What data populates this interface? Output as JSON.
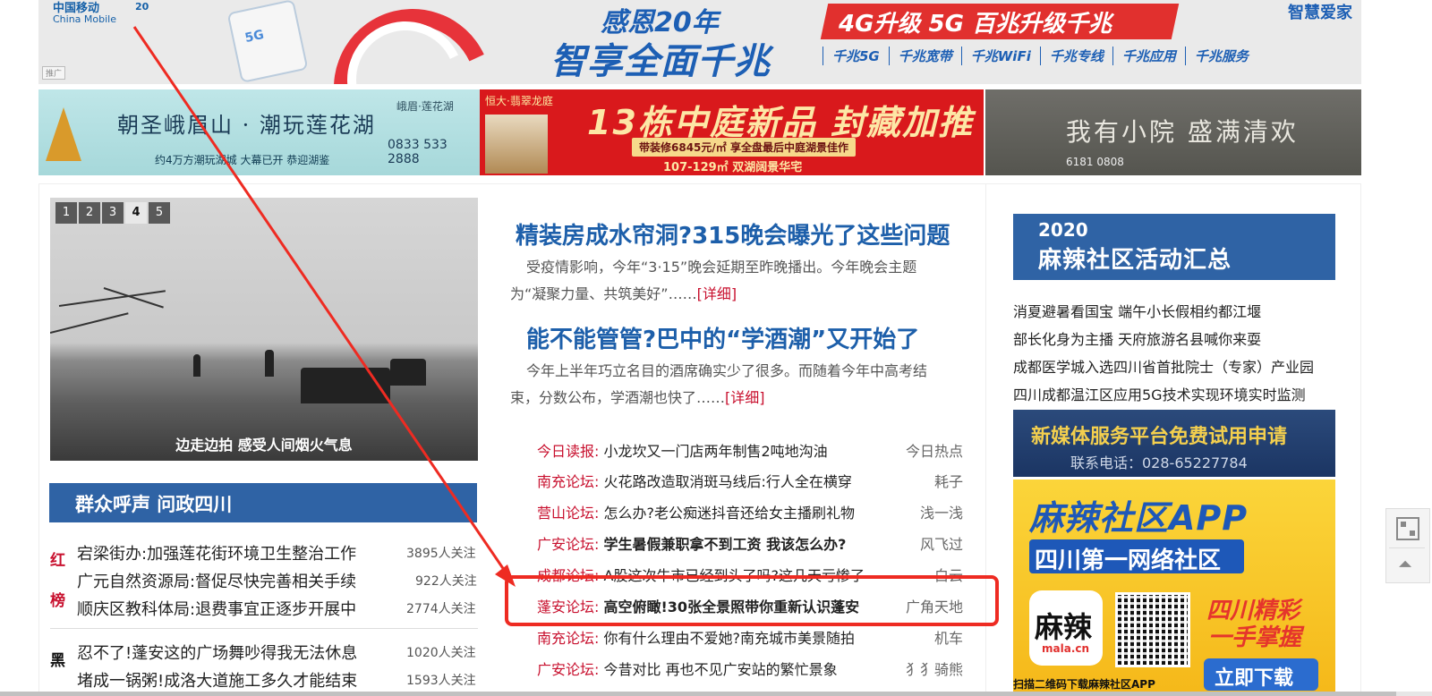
{
  "top_banner": {
    "cm_name": "中国移动",
    "cm_en": "China Mobile",
    "anniv": "20",
    "ad_tag": "推广",
    "phone_5g": "5G",
    "title_line1": "感恩20年",
    "title_line2": "智享全面千兆",
    "upgrade": "4G升级 5G   百兆升级千兆",
    "services": [
      "千兆5G",
      "千兆宽带",
      "千兆WiFi",
      "千兆专线",
      "千兆应用",
      "千兆服务"
    ],
    "smart_home": "智慧爱家"
  },
  "ads_row": {
    "a": {
      "title": "朝圣峨眉山 · 潮玩莲花湖",
      "brand": "峨眉·莲花湖",
      "phone": "0833 533 2888",
      "bottom": "约4万方潮玩湖城 大幕已开 恭迎湖鉴"
    },
    "b": {
      "brand": "恒大·翡翠龙庭",
      "title": "13栋中庭新品 封藏加推",
      "price": "带装修6845元/㎡ 享全盘最后中庭湖景佳作",
      "area": "107-129㎡ 双湖阔景华宅"
    },
    "c": {
      "title": "我有小院  盛满清欢",
      "phone": "6181 0808"
    }
  },
  "slideshow": {
    "pages": [
      "1",
      "2",
      "3",
      "4",
      "5"
    ],
    "active": "4",
    "caption": "边走边拍 感受人间烟火气息"
  },
  "voice": {
    "title": "群众呼声 问政四川",
    "red_label": [
      "红",
      "榜"
    ],
    "black_label": [
      "黑"
    ],
    "red_items": [
      {
        "title": "宕梁街办:加强莲花街环境卫生整治工作",
        "count": "3895人关注"
      },
      {
        "title": "广元自然资源局:督促尽快完善相关手续",
        "count": "922人关注"
      },
      {
        "title": "顺庆区教科体局:退费事宜正逐步开展中",
        "count": "2774人关注"
      }
    ],
    "black_items": [
      {
        "title": "忍不了!蓬安这的广场舞吵得我无法休息",
        "count": "1020人关注"
      },
      {
        "title": "堵成一锅粥!成洛大道施工多久才能结束",
        "count": "1593人关注"
      }
    ]
  },
  "headlines": [
    {
      "title": "精装房成水帘洞?315晚会曝光了这些问题",
      "line1": "受疫情影响，今年“3·15”晚会延期至昨晚播出。今年晚会主题",
      "line2": "为“凝聚力量、共筑美好”……",
      "more": "[详细]"
    },
    {
      "title": "能不能管管?巴中的“学酒潮”又开始了",
      "line1": "今年上半年巧立名目的酒席确实少了很多。而随着今年中高考结",
      "line2": "束，分数公布，学酒潮也快了……",
      "more": "[详细]"
    }
  ],
  "news": [
    {
      "src": "今日读报:",
      "title": "小龙坎又一门店两年制售2吨地沟油",
      "author": "今日热点",
      "bold": false
    },
    {
      "src": "南充论坛:",
      "title": "火花路改造取消斑马线后:行人全在横穿",
      "author": "耗子",
      "bold": false
    },
    {
      "src": "营山论坛:",
      "title": "怎么办?老公痴迷抖音还给女主播刷礼物",
      "author": "浅一浅",
      "bold": false
    },
    {
      "src": "广安论坛:",
      "title": "学生暑假兼职拿不到工资 我该怎么办?",
      "author": "风飞过",
      "bold": true
    },
    {
      "src": "成都论坛:",
      "title": "A股这次牛市已经到头了吗?这几天亏惨了",
      "author": "白云",
      "bold": false
    },
    {
      "src": "蓬安论坛:",
      "title": "高空俯瞰!30张全景照带你重新认识蓬安",
      "author": "广角天地",
      "bold": true
    },
    {
      "src": "南充论坛:",
      "title": "你有什么理由不爱她?南充城市美景随拍",
      "author": "机车",
      "bold": false
    },
    {
      "src": "广安论坛:",
      "title": "今昔对比 再也不见广安站的繁忙景象",
      "author": "犭犭骑熊",
      "bold": false
    }
  ],
  "right": {
    "summary_year": "2020",
    "summary_title": "麻辣社区活动汇总",
    "links": [
      "消夏避暑看国宝 端午小长假相约都江堰",
      "部长化身为主播 天府旅游名县喊你来耍",
      "成都医学城入选四川省首批院士（专家）产业园",
      "四川成都温江区应用5G技术实现环境实时监测"
    ],
    "media_title": "新媒体服务平台免费试用申请",
    "media_phone": "联系电话：028-65227784",
    "app_title": "麻辣社区APP",
    "app_sub": "四川第一网络社区",
    "app_icon": "麻辣",
    "app_icon_domain": "mala.cn",
    "sc_line1": "四川精彩",
    "sc_line2": "一手掌握",
    "download": "立即下载",
    "scan": "扫描二维码下载麻辣社区APP"
  },
  "side_tools": {
    "qr_icon": "qr-code-icon",
    "top_icon": "back-to-top-icon"
  },
  "colors": {
    "brand_blue": "#2f63a5",
    "link_red": "#c8102e",
    "annotation_red": "#ee2b22"
  }
}
